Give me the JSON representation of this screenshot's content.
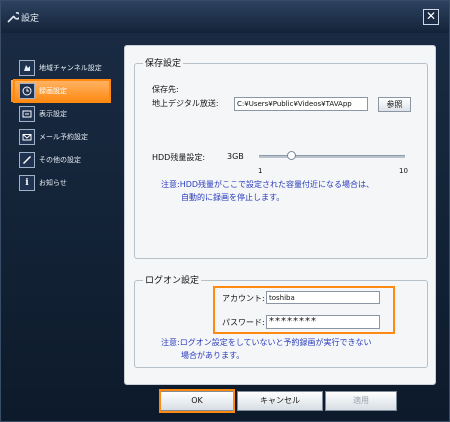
{
  "window": {
    "title": "設定",
    "close_symbol": "✕"
  },
  "sidebar": {
    "items": [
      {
        "label": "地域チャンネル設定",
        "icon": "map-icon",
        "active": false
      },
      {
        "label": "録画設定",
        "icon": "record-clock-icon",
        "active": true
      },
      {
        "label": "表示設定",
        "icon": "display-icon",
        "active": false
      },
      {
        "label": "メール予約設定",
        "icon": "mail-icon",
        "active": false
      },
      {
        "label": "その他の設定",
        "icon": "tool-icon",
        "active": false
      },
      {
        "label": "お知らせ",
        "icon": "info-icon",
        "active": false
      }
    ]
  },
  "storage_group": {
    "title": "保存設定",
    "save_to_label": "保存先:",
    "terrestrial_label": "地上デジタル放送:",
    "path_value": "C:¥Users¥Public¥Videos¥TAVApp",
    "browse_label": "参照",
    "hdd_label": "HDD残量設定:",
    "hdd_value_text": "3GB",
    "slider_min": "1",
    "slider_max": "10",
    "slider_value": 3,
    "note_line1": "注意:HDD残量がここで設定された容量付近になる場合は、",
    "note_line2": "自動的に録画を停止します。"
  },
  "logon_group": {
    "title": "ログオン設定",
    "account_label": "アカウント:",
    "account_value": "toshiba",
    "password_label": "パスワード:",
    "password_value": "********",
    "note_line1": "注意:ログオン設定をしていないと予約録画が実行できない",
    "note_line2": "場合があります。"
  },
  "buttons": {
    "ok": "OK",
    "cancel": "キャンセル",
    "apply": "適用"
  },
  "colors": {
    "accent_orange": "#ff8a12",
    "note_blue": "#2a3bbb"
  }
}
